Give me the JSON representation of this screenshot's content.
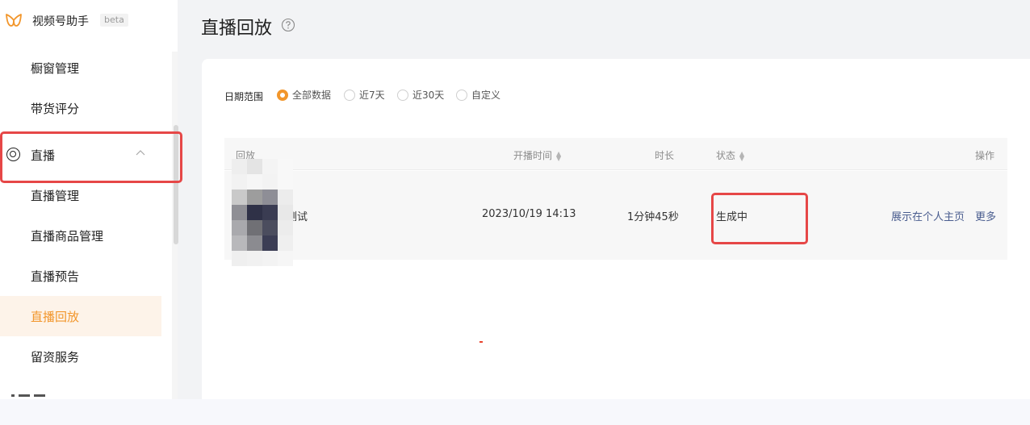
{
  "app": {
    "name": "视频号助手",
    "badge": "beta",
    "accent": "#f2962b"
  },
  "sidebar": {
    "items_top": [
      {
        "label": "橱窗管理"
      },
      {
        "label": "带货评分"
      }
    ],
    "group": {
      "label": "直播",
      "icon": "broadcast-icon",
      "expanded": true
    },
    "sub_items": [
      {
        "label": "直播管理",
        "active": false
      },
      {
        "label": "直播商品管理",
        "active": false
      },
      {
        "label": "直播预告",
        "active": false
      },
      {
        "label": "直播回放",
        "active": true
      },
      {
        "label": "留资服务",
        "active": false
      }
    ]
  },
  "page": {
    "title": "直播回放",
    "help_icon": "question-circle-icon"
  },
  "filter": {
    "label": "日期范围",
    "options": [
      {
        "label": "全部数据",
        "checked": true
      },
      {
        "label": "近7天",
        "checked": false
      },
      {
        "label": "近30天",
        "checked": false
      },
      {
        "label": "自定义",
        "checked": false
      }
    ]
  },
  "table": {
    "columns": {
      "replay": "回放",
      "start_time": "开播时间",
      "duration": "时长",
      "status": "状态",
      "actions": "操作"
    },
    "rows": [
      {
        "title": "测试",
        "start_time": "2023/10/19 14:13",
        "duration": "1分钟45秒",
        "status": "生成中",
        "action_primary": "展示在个人主页",
        "action_more": "更多"
      }
    ]
  },
  "annotation_color": "#e64747"
}
